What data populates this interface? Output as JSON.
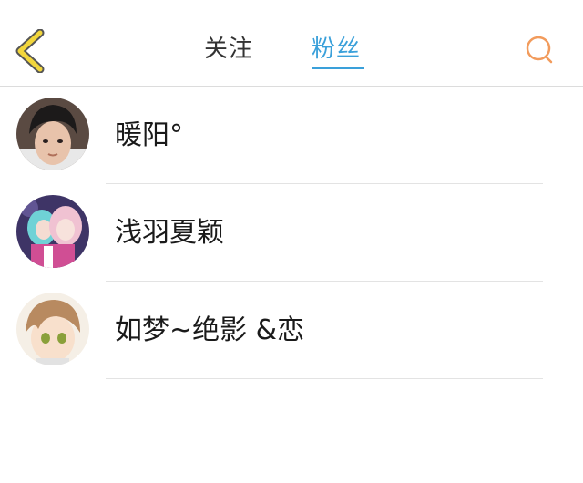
{
  "header": {
    "back_icon": "chevron-left-icon",
    "tabs": [
      {
        "label": "关注",
        "active": false
      },
      {
        "label": "粉丝",
        "active": true
      }
    ],
    "search_icon": "search-icon",
    "colors": {
      "active_tab": "#3aa0da",
      "back_icon": "#f2d63c",
      "search_icon": "#f29b5c"
    }
  },
  "followers": [
    {
      "name": "暖阳°",
      "avatar": "avatar-photo-young-man"
    },
    {
      "name": "浅羽夏颖",
      "avatar": "avatar-anime-girls"
    },
    {
      "name": "如梦~绝影 &恋",
      "avatar": "avatar-anime-boy"
    }
  ]
}
